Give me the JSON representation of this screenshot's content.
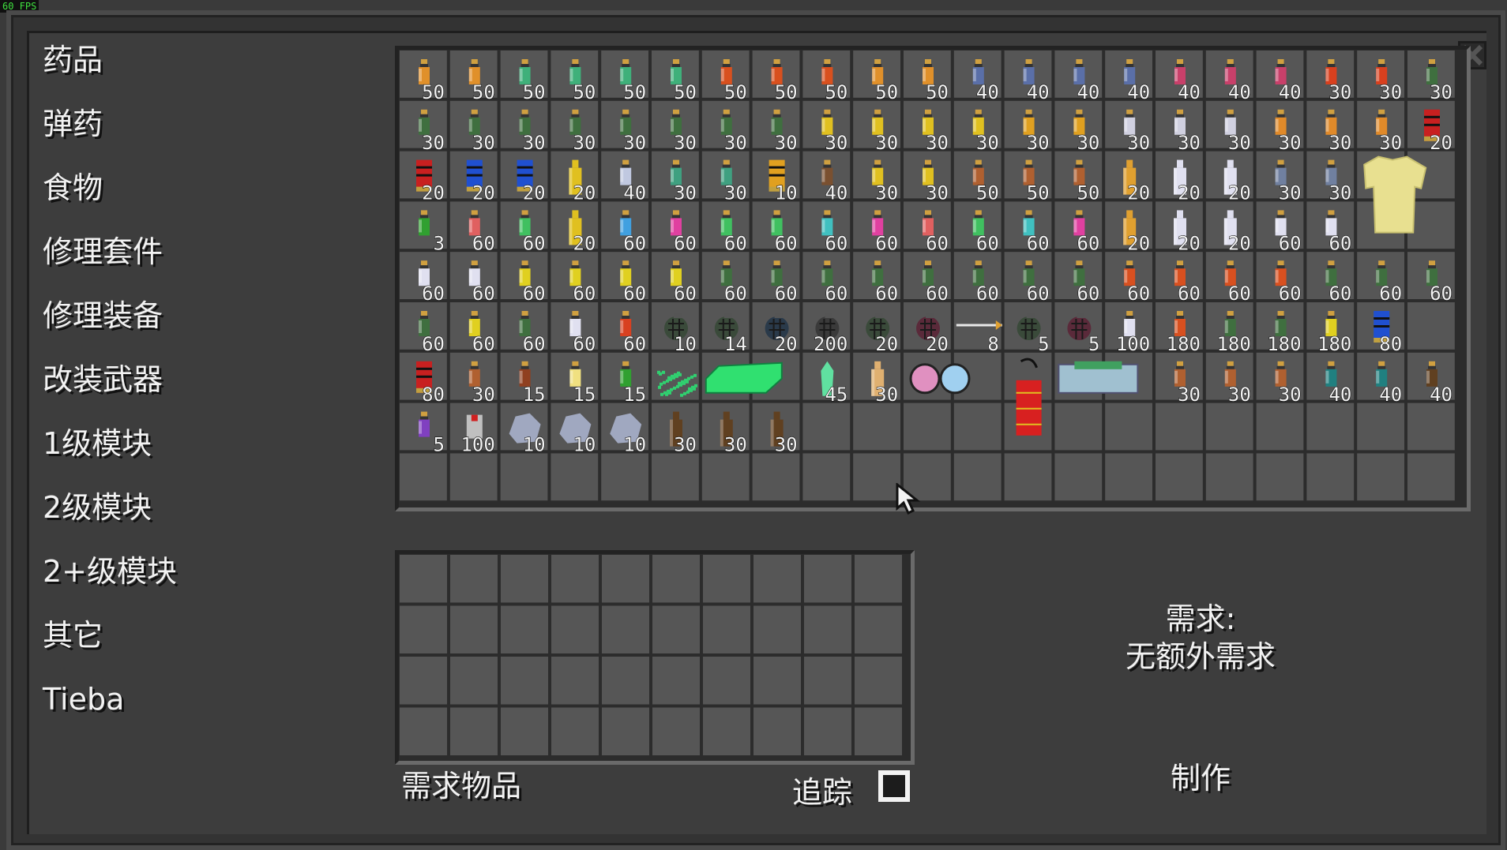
{
  "fps": "60 FPS",
  "sidebar": {
    "items": [
      {
        "label": "药品"
      },
      {
        "label": "弹药"
      },
      {
        "label": "食物"
      },
      {
        "label": "修理套件"
      },
      {
        "label": "修理装备"
      },
      {
        "label": "改装武器"
      },
      {
        "label": "1级模块"
      },
      {
        "label": "2级模块"
      },
      {
        "label": "2+级模块"
      },
      {
        "label": "其它"
      },
      {
        "label": "Tieba"
      }
    ]
  },
  "inventory": {
    "rows": [
      [
        {
          "kind": "bottle",
          "color": "#e0902a",
          "count": "50"
        },
        {
          "kind": "bottle",
          "color": "#e0902a",
          "count": "50"
        },
        {
          "kind": "bottle",
          "color": "#3fb07a",
          "count": "50"
        },
        {
          "kind": "bottle",
          "color": "#3fb07a",
          "count": "50"
        },
        {
          "kind": "bottle",
          "color": "#3fb07a",
          "count": "50"
        },
        {
          "kind": "bottle",
          "color": "#3fb07a",
          "count": "50"
        },
        {
          "kind": "bottle",
          "color": "#d8501e",
          "count": "50"
        },
        {
          "kind": "bottle",
          "color": "#d8501e",
          "count": "50"
        },
        {
          "kind": "bottle",
          "color": "#d8501e",
          "count": "50"
        },
        {
          "kind": "bottle",
          "color": "#e0902a",
          "count": "50"
        },
        {
          "kind": "bottle",
          "color": "#e0902a",
          "count": "50"
        },
        {
          "kind": "bottle",
          "color": "#5a6fa8",
          "count": "40"
        },
        {
          "kind": "bottle",
          "color": "#5a6fa8",
          "count": "40"
        },
        {
          "kind": "bottle",
          "color": "#5a6fa8",
          "count": "40"
        },
        {
          "kind": "bottle",
          "color": "#5a6fa8",
          "count": "40"
        },
        {
          "kind": "bottle",
          "color": "#c8406a",
          "count": "40"
        },
        {
          "kind": "bottle",
          "color": "#c8406a",
          "count": "40"
        },
        {
          "kind": "bottle",
          "color": "#c8406a",
          "count": "40"
        },
        {
          "kind": "bottle",
          "color": "#d8401e",
          "count": "30"
        },
        {
          "kind": "bottle",
          "color": "#d8401e",
          "count": "30"
        },
        {
          "kind": "bottle",
          "color": "#3f6f3f",
          "count": "30"
        }
      ],
      [
        {
          "kind": "bottle",
          "color": "#3f6f3f",
          "count": "30"
        },
        {
          "kind": "bottle",
          "color": "#3f6f3f",
          "count": "30"
        },
        {
          "kind": "bottle",
          "color": "#3f6f3f",
          "count": "30"
        },
        {
          "kind": "bottle",
          "color": "#3f6f3f",
          "count": "30"
        },
        {
          "kind": "bottle",
          "color": "#3f6f3f",
          "count": "30"
        },
        {
          "kind": "bottle",
          "color": "#3f6f3f",
          "count": "30"
        },
        {
          "kind": "bottle",
          "color": "#3f6f3f",
          "count": "30"
        },
        {
          "kind": "bottle",
          "color": "#3f6f3f",
          "count": "30"
        },
        {
          "kind": "bottle",
          "color": "#e0c020",
          "count": "30"
        },
        {
          "kind": "bottle",
          "color": "#e0c020",
          "count": "30"
        },
        {
          "kind": "bottle",
          "color": "#e0c020",
          "count": "30"
        },
        {
          "kind": "bottle",
          "color": "#e0c020",
          "count": "30"
        },
        {
          "kind": "bottle",
          "color": "#e0a020",
          "count": "30"
        },
        {
          "kind": "bottle",
          "color": "#e0a020",
          "count": "30"
        },
        {
          "kind": "bottle",
          "color": "#d0d0e0",
          "count": "30"
        },
        {
          "kind": "bottle",
          "color": "#d0d0e0",
          "count": "30"
        },
        {
          "kind": "bottle",
          "color": "#d0d0e0",
          "count": "30"
        },
        {
          "kind": "bottle",
          "color": "#e08a2a",
          "count": "30"
        },
        {
          "kind": "bottle",
          "color": "#e08a2a",
          "count": "30"
        },
        {
          "kind": "bottle",
          "color": "#e08a2a",
          "count": "30"
        },
        {
          "kind": "shell",
          "color": "#c82020",
          "count": "20"
        }
      ],
      [
        {
          "kind": "shell",
          "color": "#c82020",
          "count": "20"
        },
        {
          "kind": "shell",
          "color": "#2050d0",
          "count": "20"
        },
        {
          "kind": "shell",
          "color": "#2050d0",
          "count": "20"
        },
        {
          "kind": "tall",
          "color": "#e0c020",
          "count": "20"
        },
        {
          "kind": "bottle",
          "color": "#c0c8e0",
          "count": "40"
        },
        {
          "kind": "bottle",
          "color": "#3fa080",
          "count": "30"
        },
        {
          "kind": "bottle",
          "color": "#3fa080",
          "count": "30"
        },
        {
          "kind": "shell",
          "color": "#e0a020",
          "count": "10"
        },
        {
          "kind": "bottle",
          "color": "#7a5030",
          "count": "40"
        },
        {
          "kind": "bottle",
          "color": "#e0c020",
          "count": "30"
        },
        {
          "kind": "bottle",
          "color": "#e0c020",
          "count": "30"
        },
        {
          "kind": "bottle",
          "color": "#b06030",
          "count": "50"
        },
        {
          "kind": "bottle",
          "color": "#b06030",
          "count": "50"
        },
        {
          "kind": "bottle",
          "color": "#b06030",
          "count": "50"
        },
        {
          "kind": "tall",
          "color": "#e0a030",
          "count": "20"
        },
        {
          "kind": "tall",
          "color": "#e0e0f0",
          "count": "20"
        },
        {
          "kind": "tall",
          "color": "#e0e0f0",
          "count": "20"
        },
        {
          "kind": "bottle",
          "color": "#7080a0",
          "count": "30"
        },
        {
          "kind": "bottle",
          "color": "#7080a0",
          "count": "30"
        },
        {
          "kind": "armor",
          "color": "#e8e090",
          "count": ""
        }
      ],
      [
        {
          "kind": "bottle",
          "color": "#30a030",
          "count": "3"
        },
        {
          "kind": "bottle",
          "color": "#e06060",
          "count": "60"
        },
        {
          "kind": "bottle",
          "color": "#40c060",
          "count": "60"
        },
        {
          "kind": "tall",
          "color": "#e0c020",
          "count": "20"
        },
        {
          "kind": "bottle",
          "color": "#40a0e0",
          "count": "60"
        },
        {
          "kind": "bottle",
          "color": "#e040a0",
          "count": "60"
        },
        {
          "kind": "bottle",
          "color": "#40c060",
          "count": "60"
        },
        {
          "kind": "bottle",
          "color": "#40c060",
          "count": "60"
        },
        {
          "kind": "bottle",
          "color": "#40c0c0",
          "count": "60"
        },
        {
          "kind": "bottle",
          "color": "#e040a0",
          "count": "60"
        },
        {
          "kind": "bottle",
          "color": "#e06060",
          "count": "60"
        },
        {
          "kind": "bottle",
          "color": "#40c060",
          "count": "60"
        },
        {
          "kind": "bottle",
          "color": "#40c0c0",
          "count": "60"
        },
        {
          "kind": "bottle",
          "color": "#e040a0",
          "count": "60"
        },
        {
          "kind": "tall",
          "color": "#e0a030",
          "count": "20"
        },
        {
          "kind": "tall",
          "color": "#e0e0f0",
          "count": "20"
        },
        {
          "kind": "tall",
          "color": "#e0e0f0",
          "count": "20"
        },
        {
          "kind": "bottle",
          "color": "#e0e0f0",
          "count": "60"
        },
        {
          "kind": "bottle",
          "color": "#e0e0f0",
          "count": "60"
        }
      ],
      [
        {
          "kind": "bottle",
          "color": "#e0e0f0",
          "count": "60"
        },
        {
          "kind": "bottle",
          "color": "#e0e0f0",
          "count": "60"
        },
        {
          "kind": "bottle",
          "color": "#e0d020",
          "count": "60"
        },
        {
          "kind": "bottle",
          "color": "#e0d020",
          "count": "60"
        },
        {
          "kind": "bottle",
          "color": "#e0d020",
          "count": "60"
        },
        {
          "kind": "bottle",
          "color": "#e0d020",
          "count": "60"
        },
        {
          "kind": "bottle",
          "color": "#3f6f3f",
          "count": "60"
        },
        {
          "kind": "bottle",
          "color": "#3f6f3f",
          "count": "60"
        },
        {
          "kind": "bottle",
          "color": "#3f6f3f",
          "count": "60"
        },
        {
          "kind": "bottle",
          "color": "#3f6f3f",
          "count": "60"
        },
        {
          "kind": "bottle",
          "color": "#3f6f3f",
          "count": "60"
        },
        {
          "kind": "bottle",
          "color": "#3f6f3f",
          "count": "60"
        },
        {
          "kind": "bottle",
          "color": "#3f6f3f",
          "count": "60"
        },
        {
          "kind": "bottle",
          "color": "#3f6f3f",
          "count": "60"
        },
        {
          "kind": "bottle",
          "color": "#d85020",
          "count": "60"
        },
        {
          "kind": "bottle",
          "color": "#d85020",
          "count": "60"
        },
        {
          "kind": "bottle",
          "color": "#d85020",
          "count": "60"
        },
        {
          "kind": "bottle",
          "color": "#d85020",
          "count": "60"
        },
        {
          "kind": "bottle",
          "color": "#3f6f3f",
          "count": "60"
        },
        {
          "kind": "bottle",
          "color": "#3f6f3f",
          "count": "60"
        },
        {
          "kind": "bottle",
          "color": "#3f6f3f",
          "count": "60"
        }
      ],
      [
        {
          "kind": "bottle",
          "color": "#3f6f3f",
          "count": "60"
        },
        {
          "kind": "bottle",
          "color": "#e0d020",
          "count": "60"
        },
        {
          "kind": "bottle",
          "color": "#3f6f3f",
          "count": "60"
        },
        {
          "kind": "bottle",
          "color": "#e0e0f0",
          "count": "60"
        },
        {
          "kind": "bottle",
          "color": "#d84020",
          "count": "60"
        },
        {
          "kind": "grenade",
          "color": "#3a4a3a",
          "count": "10"
        },
        {
          "kind": "grenade",
          "color": "#3a4a3a",
          "count": "14"
        },
        {
          "kind": "grenade",
          "color": "#2a3a4a",
          "count": "20"
        },
        {
          "kind": "grenade",
          "color": "#3a3a3a",
          "count": "200"
        },
        {
          "kind": "grenade",
          "color": "#3a4a3a",
          "count": "20"
        },
        {
          "kind": "grenade",
          "color": "#5a2a3a",
          "count": "20"
        },
        {
          "kind": "arrow",
          "color": "#e0a030",
          "count": "8"
        },
        {
          "kind": "grenade",
          "color": "#3a4a3a",
          "count": "5"
        },
        {
          "kind": "grenade",
          "color": "#5a2a3a",
          "count": "5"
        },
        {
          "kind": "bottle",
          "color": "#e0e0f0",
          "count": "100"
        },
        {
          "kind": "bottle",
          "color": "#d85020",
          "count": "180"
        },
        {
          "kind": "bottle",
          "color": "#3f6f3f",
          "count": "180"
        },
        {
          "kind": "bottle",
          "color": "#3f6f3f",
          "count": "180"
        },
        {
          "kind": "bottle",
          "color": "#e0d020",
          "count": "180"
        },
        {
          "kind": "shell",
          "color": "#2050d0",
          "count": "80"
        }
      ],
      [
        {
          "kind": "shell",
          "color": "#c82020",
          "count": "80"
        },
        {
          "kind": "bottle",
          "color": "#b06030",
          "count": "30"
        },
        {
          "kind": "bottle",
          "color": "#904020",
          "count": "15"
        },
        {
          "kind": "bottle",
          "color": "#f0e080",
          "count": "15"
        },
        {
          "kind": "bottle",
          "color": "#30a030",
          "count": "15"
        },
        {
          "kind": "dust",
          "color": "#30d070",
          "count": ""
        },
        {
          "kind": "bar",
          "color": "#30e070",
          "count": ""
        },
        {
          "kind": "crystal",
          "color": "#60e0a0",
          "count": "45"
        },
        {
          "kind": "tall",
          "color": "#e0b070",
          "count": "30"
        },
        {
          "kind": "goggles",
          "color": "#e060a0",
          "count": ""
        },
        {
          "kind": "dynamite",
          "color": "#d82020",
          "count": ""
        },
        {
          "kind": "device",
          "color": "#40a060",
          "count": ""
        },
        {
          "kind": "bottle",
          "color": "#b06030",
          "count": "30"
        },
        {
          "kind": "bottle",
          "color": "#b06030",
          "count": "30"
        },
        {
          "kind": "bottle",
          "color": "#b06030",
          "count": "30"
        },
        {
          "kind": "bottle",
          "color": "#208080",
          "count": "40"
        },
        {
          "kind": "bottle",
          "color": "#208080",
          "count": "40"
        },
        {
          "kind": "bottle",
          "color": "#604020",
          "count": "40"
        }
      ],
      [
        {
          "kind": "bottle",
          "color": "#8040c0",
          "count": "5"
        },
        {
          "kind": "box",
          "color": "#c0c0c0",
          "count": "100"
        },
        {
          "kind": "rock",
          "color": "#a0a8c0",
          "count": "10"
        },
        {
          "kind": "rock",
          "color": "#a0a8c0",
          "count": "10"
        },
        {
          "kind": "rock",
          "color": "#a0a8c0",
          "count": "10"
        },
        {
          "kind": "tall",
          "color": "#604020",
          "count": "30"
        },
        {
          "kind": "tall",
          "color": "#604020",
          "count": "30"
        },
        {
          "kind": "tall",
          "color": "#604020",
          "count": "30"
        }
      ]
    ]
  },
  "required": {
    "label": "需求物品",
    "track_label": "追踪",
    "track_checked": false
  },
  "requirement": {
    "title": "需求:",
    "text": "无额外需求"
  },
  "craft_label": "制作"
}
